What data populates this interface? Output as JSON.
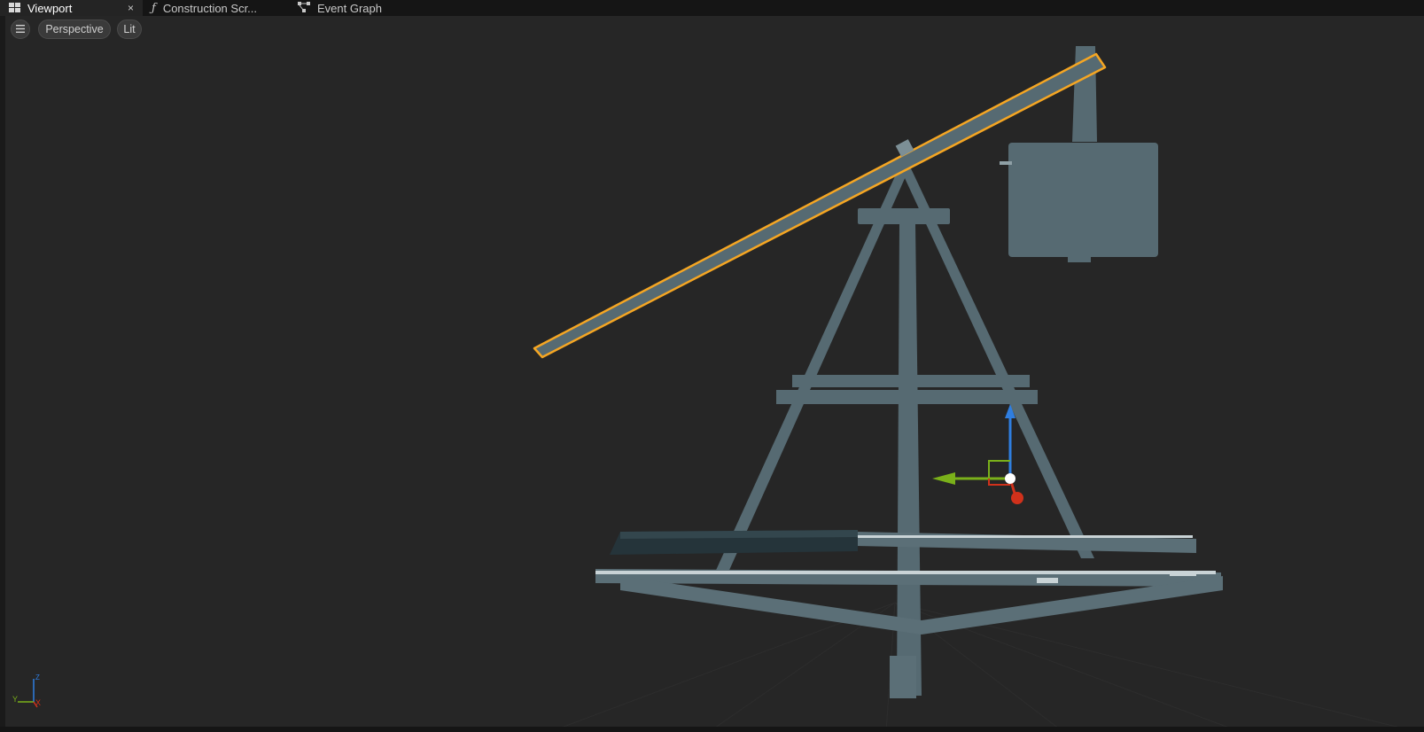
{
  "tabs": [
    {
      "label": "Viewport",
      "icon": "viewport-grid-icon",
      "active": true
    },
    {
      "label": "Construction Scr...",
      "icon": "function-icon",
      "active": false
    },
    {
      "label": "Event Graph",
      "icon": "event-graph-icon",
      "active": false
    }
  ],
  "tab_close_glyph": "×",
  "toolbar": {
    "menu_icon": "hamburger-menu-icon",
    "perspective_label": "Perspective",
    "lit_label": "Lit"
  },
  "axis_indicator": {
    "y_label": "Y",
    "x_label": "X",
    "z_label": "Z"
  },
  "colors": {
    "selection_outline": "#f5a623",
    "mesh": "#566a72",
    "gizmo_x": "#d0311b",
    "gizmo_y": "#7ab01a",
    "gizmo_z": "#2f7ee0",
    "viewport_bg": "#262626"
  }
}
